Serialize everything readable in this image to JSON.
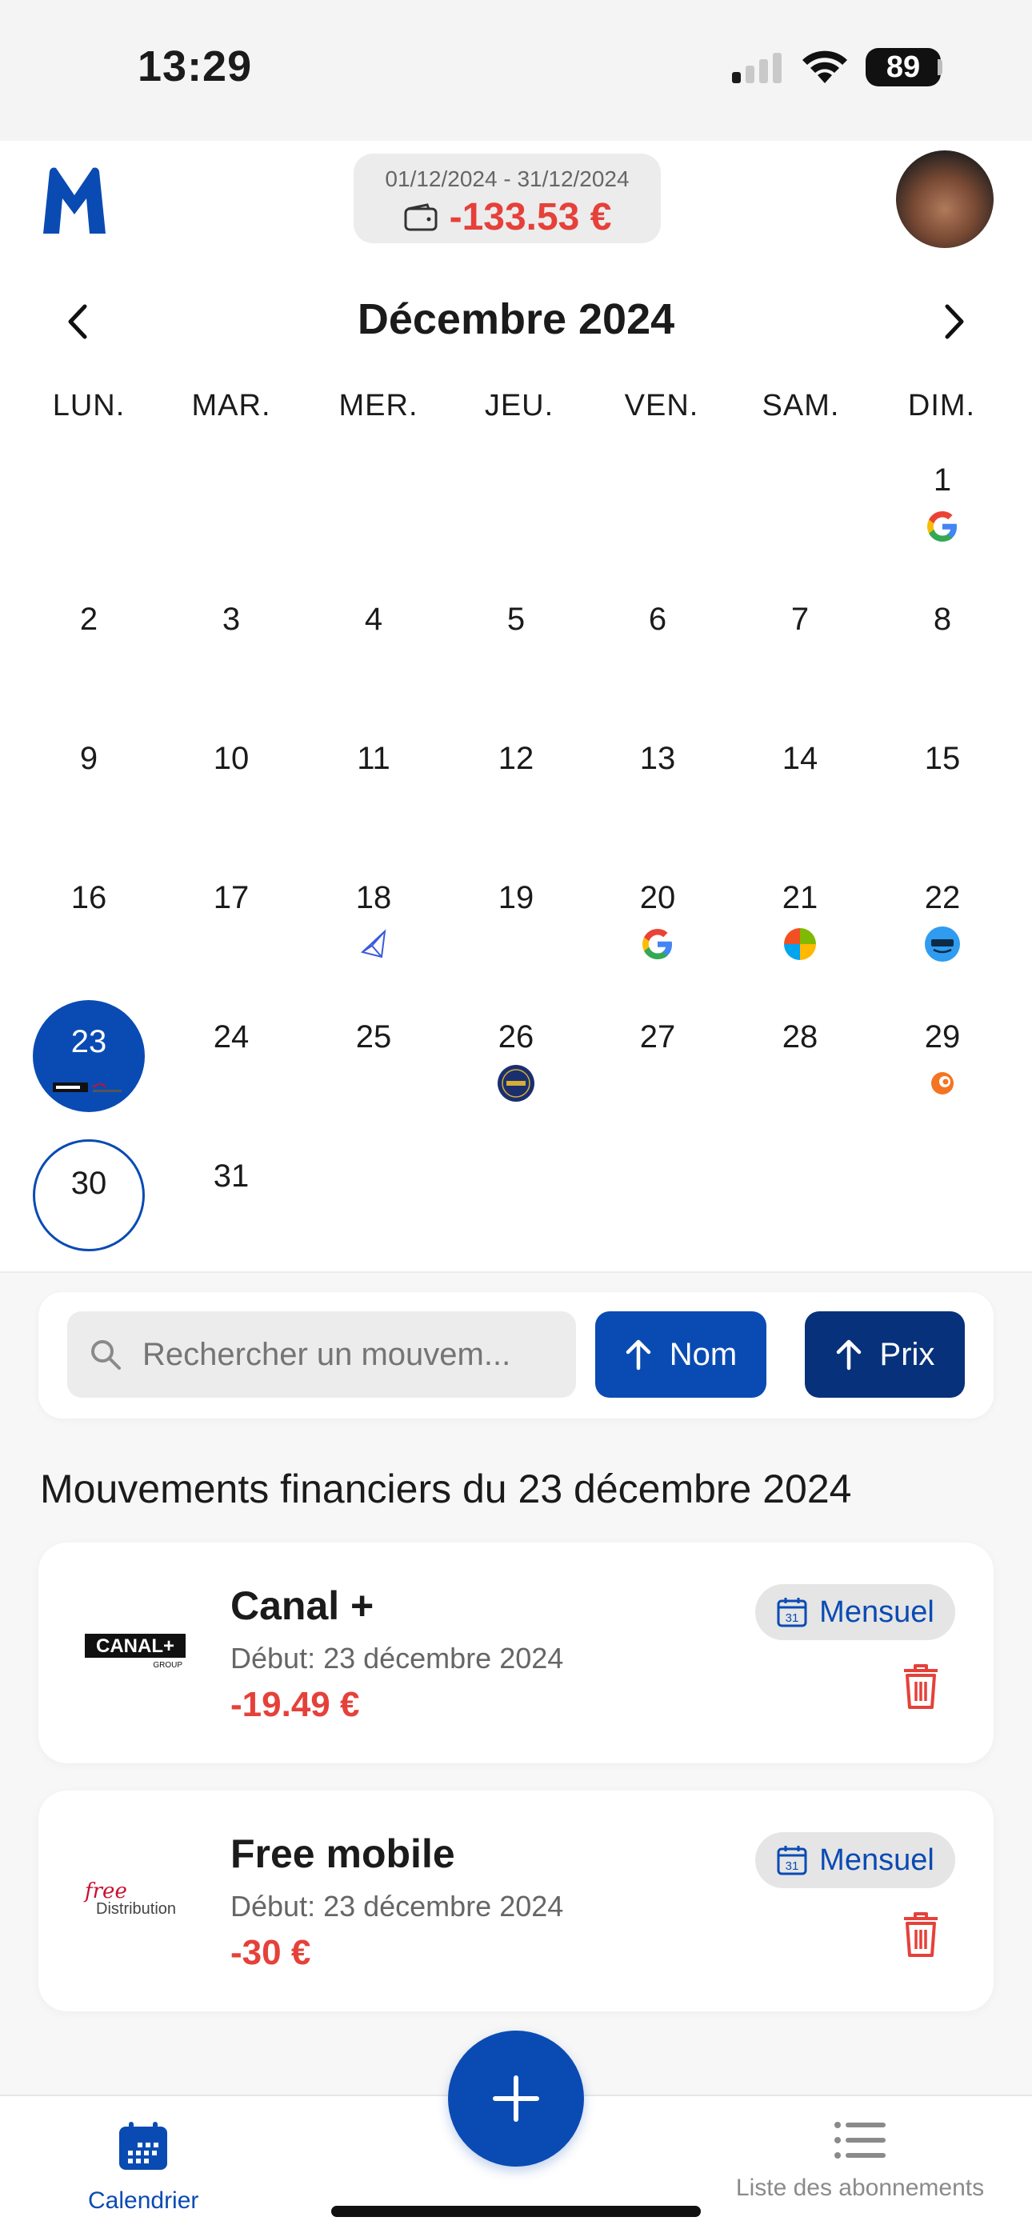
{
  "status_bar": {
    "time": "13:29",
    "battery": "89"
  },
  "header": {
    "period_range": "01/12/2024 - 31/12/2024",
    "period_total": "-133.53 €"
  },
  "calendar": {
    "month_title": "Décembre 2024",
    "weekdays": [
      "LUN.",
      "MAR.",
      "MER.",
      "JEU.",
      "VEN.",
      "SAM.",
      "DIM."
    ],
    "days": [
      "1",
      "2",
      "3",
      "4",
      "5",
      "6",
      "7",
      "8",
      "9",
      "10",
      "11",
      "12",
      "13",
      "14",
      "15",
      "16",
      "17",
      "18",
      "19",
      "20",
      "21",
      "22",
      "23",
      "24",
      "25",
      "26",
      "27",
      "28",
      "29",
      "30",
      "31"
    ],
    "selected_day": "23",
    "today": "30",
    "day_icons": {
      "1": [
        "google-icon"
      ],
      "18": [
        "service-triangle-icon"
      ],
      "20": [
        "google-icon"
      ],
      "21": [
        "microsoft-icon"
      ],
      "22": [
        "prime-icon"
      ],
      "23": [
        "canal-plus-icon",
        "free-icon"
      ],
      "26": [
        "lcl-icon"
      ],
      "29": [
        "crunchyroll-icon"
      ]
    }
  },
  "search": {
    "placeholder": "Rechercher un mouvem..."
  },
  "sort": {
    "name_label": "Nom",
    "price_label": "Prix"
  },
  "section_title": "Mouvements financiers du 23 décembre 2024",
  "transactions": [
    {
      "name": "Canal +",
      "start": "Début: 23 décembre 2024",
      "amount": "-19.49 €",
      "frequency": "Mensuel",
      "logo_text": "CANAL+",
      "logo_sub": "GROUP"
    },
    {
      "name": "Free mobile",
      "start": "Début: 23 décembre 2024",
      "amount": "-30 €",
      "frequency": "Mensuel",
      "logo_text": "free",
      "logo_sub": "Distribution"
    }
  ],
  "calendar_icon_number": "31",
  "tabbar": {
    "calendar_label": "Calendrier",
    "list_label": "Liste des abonnements"
  },
  "colors": {
    "primary": "#0a4bb3",
    "primary_dark": "#07317a",
    "negative": "#e5413a"
  }
}
